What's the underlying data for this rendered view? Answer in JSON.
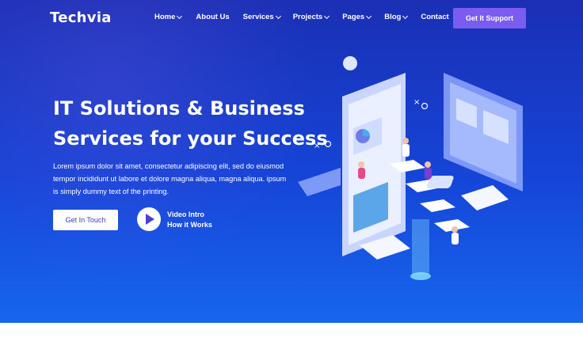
{
  "brand": {
    "logo": "Techvia"
  },
  "nav": {
    "items": [
      {
        "label": "Home",
        "dropdown": true
      },
      {
        "label": "About Us",
        "dropdown": false
      },
      {
        "label": "Services",
        "dropdown": true
      },
      {
        "label": "Projects",
        "dropdown": true
      },
      {
        "label": "Pages",
        "dropdown": true
      },
      {
        "label": "Blog",
        "dropdown": true
      },
      {
        "label": "Contact",
        "dropdown": false
      }
    ],
    "cta_label": "Get It Support"
  },
  "hero": {
    "headline_line1": "IT Solutions & Business",
    "headline_line2": "Services for your Success",
    "description": "Lorem ipsum dolor sit amet, consectetur adipiscing elit, sed do eiusmod tempor incididunt ut labore et dolore magna aliqua, magna aliqua. ipsum is simply dummy text of the printing.",
    "primary_button": "Get In Touch",
    "video_line1": "Video Intro",
    "video_line2": "How it Works"
  },
  "colors": {
    "hero_top": "#1a2fb4",
    "hero_bottom": "#1766ee",
    "accent_button": "#7b5cf0",
    "play_icon": "#4c3fd6"
  },
  "icons": [
    "chevron-down-icon",
    "play-icon"
  ]
}
